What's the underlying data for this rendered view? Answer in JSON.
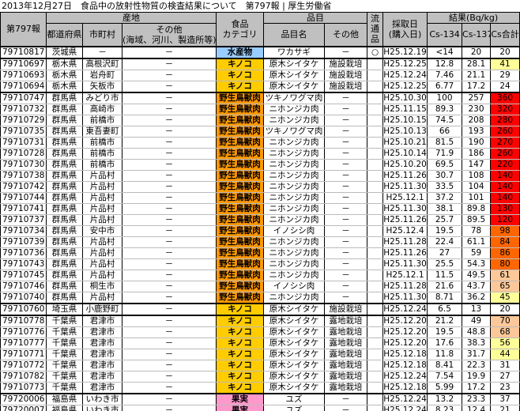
{
  "title": "2013年12月27日　食品中の放射性物質の検査結果について　第797報 | 厚生労働省",
  "header": {
    "report": "第797報",
    "origin": "産地",
    "prefecture": "都道府県",
    "city": "市町村",
    "origin_other": "その他",
    "origin_other_note": "(海域、河川、製造所等)",
    "category": "食品",
    "category2": "カテゴリ",
    "item": "品目",
    "item_name": "品目名",
    "item_other": "その他",
    "distributed": "流",
    "distributed2": "通",
    "distributed3": "品",
    "date": "採取日",
    "date2": "(購入日)",
    "result": "結果(Bq/kg)",
    "cs134": "Cs-134",
    "cs137": "Cs-137",
    "cs_total": "Cs合計"
  },
  "colors": {
    "header": "#c0c0c0",
    "category": {
      "水産物": "#99ccff",
      "キノコ": "#ffcc00",
      "野生鳥獣肉": "#ff9900",
      "果実": "#ff99cc"
    },
    "total_highlight": {
      "over_100": "#ff0000",
      "80_99": "#ff6600",
      "60_79": "#fcc89a",
      "40_59": "#ffff99"
    }
  },
  "rows": [
    {
      "id": "79710817",
      "pref": "茨城県",
      "city": "－",
      "other": "－",
      "cat": "水産物",
      "item": "ワカサギ",
      "item_other": "－",
      "dist": "○",
      "date": "H25.12.19",
      "cs134": "<14",
      "cs137": "20",
      "total": "20",
      "grp": true
    },
    {
      "id": "79710697",
      "pref": "栃木県",
      "city": "高根沢町",
      "other": "－",
      "cat": "キノコ",
      "item": "原木シイタケ",
      "item_other": "施設栽培",
      "dist": "",
      "date": "H25.12.25",
      "cs134": "12.8",
      "cs137": "28.1",
      "total": "41",
      "grp": true
    },
    {
      "id": "79710693",
      "pref": "栃木県",
      "city": "岩舟町",
      "other": "－",
      "cat": "キノコ",
      "item": "原木シイタケ",
      "item_other": "施設栽培",
      "dist": "",
      "date": "H25.12.24",
      "cs134": "7.46",
      "cs137": "21.1",
      "total": "29"
    },
    {
      "id": "79710694",
      "pref": "栃木県",
      "city": "矢板市",
      "other": "－",
      "cat": "キノコ",
      "item": "原木シイタケ",
      "item_other": "施設栽培",
      "dist": "",
      "date": "H25.12.25",
      "cs134": "6.77",
      "cs137": "17.2",
      "total": "24"
    },
    {
      "id": "79710747",
      "pref": "群馬県",
      "city": "みどり市",
      "other": "－",
      "cat": "野生鳥獣肉",
      "item": "ツキノワグマ肉",
      "item_other": "－",
      "dist": "",
      "date": "H25.10.30",
      "cs134": "100",
      "cs137": "257",
      "total": "360",
      "grp": true
    },
    {
      "id": "79710732",
      "pref": "群馬県",
      "city": "高崎市",
      "other": "－",
      "cat": "野生鳥獣肉",
      "item": "ニホンジカ肉",
      "item_other": "－",
      "dist": "",
      "date": "H25.11.15",
      "cs134": "89.3",
      "cs137": "230",
      "total": "320"
    },
    {
      "id": "79710729",
      "pref": "群馬県",
      "city": "前橋市",
      "other": "－",
      "cat": "野生鳥獣肉",
      "item": "ニホンジカ肉",
      "item_other": "－",
      "dist": "",
      "date": "H25.10.15",
      "cs134": "74.5",
      "cs137": "208",
      "total": "280"
    },
    {
      "id": "79710735",
      "pref": "群馬県",
      "city": "東吾妻町",
      "other": "－",
      "cat": "野生鳥獣肉",
      "item": "ツキノワグマ肉",
      "item_other": "－",
      "dist": "",
      "date": "H25.10.13",
      "cs134": "66",
      "cs137": "193",
      "total": "260"
    },
    {
      "id": "79710731",
      "pref": "群馬県",
      "city": "前橋市",
      "other": "－",
      "cat": "野生鳥獣肉",
      "item": "ニホンジカ肉",
      "item_other": "－",
      "dist": "",
      "date": "H25.10.21",
      "cs134": "81.5",
      "cs137": "190",
      "total": "270"
    },
    {
      "id": "79710728",
      "pref": "群馬県",
      "city": "前橋市",
      "other": "－",
      "cat": "野生鳥獣肉",
      "item": "ニホンジカ肉",
      "item_other": "－",
      "dist": "",
      "date": "H25.10.14",
      "cs134": "71.9",
      "cs137": "186",
      "total": "260"
    },
    {
      "id": "79710730",
      "pref": "群馬県",
      "city": "前橋市",
      "other": "－",
      "cat": "野生鳥獣肉",
      "item": "ニホンジカ肉",
      "item_other": "－",
      "dist": "",
      "date": "H25.10.20",
      "cs134": "69.5",
      "cs137": "147",
      "total": "220"
    },
    {
      "id": "79710738",
      "pref": "群馬県",
      "city": "片品村",
      "other": "－",
      "cat": "野生鳥獣肉",
      "item": "ニホンジカ肉",
      "item_other": "－",
      "dist": "",
      "date": "H25.11.26",
      "cs134": "30.7",
      "cs137": "108",
      "total": "140"
    },
    {
      "id": "79710742",
      "pref": "群馬県",
      "city": "片品村",
      "other": "－",
      "cat": "野生鳥獣肉",
      "item": "ニホンジカ肉",
      "item_other": "－",
      "dist": "",
      "date": "H25.11.30",
      "cs134": "33.5",
      "cs137": "104",
      "total": "140"
    },
    {
      "id": "79710744",
      "pref": "群馬県",
      "city": "片品村",
      "other": "－",
      "cat": "野生鳥獣肉",
      "item": "ニホンジカ肉",
      "item_other": "－",
      "dist": "",
      "date": "H25.12.1",
      "cs134": "37.2",
      "cs137": "101",
      "total": "140"
    },
    {
      "id": "79710741",
      "pref": "群馬県",
      "city": "片品村",
      "other": "－",
      "cat": "野生鳥獣肉",
      "item": "ニホンジカ肉",
      "item_other": "－",
      "dist": "",
      "date": "H25.11.30",
      "cs134": "38.1",
      "cs137": "89.8",
      "total": "130"
    },
    {
      "id": "79710737",
      "pref": "群馬県",
      "city": "片品村",
      "other": "－",
      "cat": "野生鳥獣肉",
      "item": "ニホンジカ肉",
      "item_other": "－",
      "dist": "",
      "date": "H25.11.26",
      "cs134": "25.7",
      "cs137": "89.5",
      "total": "120"
    },
    {
      "id": "79710734",
      "pref": "群馬県",
      "city": "安中市",
      "other": "－",
      "cat": "野生鳥獣肉",
      "item": "イノシシ肉",
      "item_other": "－",
      "dist": "",
      "date": "H25.12.4",
      "cs134": "19.5",
      "cs137": "78",
      "total": "98"
    },
    {
      "id": "79710739",
      "pref": "群馬県",
      "city": "片品村",
      "other": "－",
      "cat": "野生鳥獣肉",
      "item": "ニホンジカ肉",
      "item_other": "－",
      "dist": "",
      "date": "H25.11.28",
      "cs134": "22.4",
      "cs137": "61.1",
      "total": "84"
    },
    {
      "id": "79710736",
      "pref": "群馬県",
      "city": "片品村",
      "other": "－",
      "cat": "野生鳥獣肉",
      "item": "ニホンジカ肉",
      "item_other": "－",
      "dist": "",
      "date": "H25.11.26",
      "cs134": "27",
      "cs137": "59",
      "total": "86"
    },
    {
      "id": "79710743",
      "pref": "群馬県",
      "city": "片品村",
      "other": "－",
      "cat": "野生鳥獣肉",
      "item": "ニホンジカ肉",
      "item_other": "－",
      "dist": "",
      "date": "H25.11.30",
      "cs134": "25.5",
      "cs137": "54.3",
      "total": "80"
    },
    {
      "id": "79710745",
      "pref": "群馬県",
      "city": "片品村",
      "other": "－",
      "cat": "野生鳥獣肉",
      "item": "ニホンジカ肉",
      "item_other": "－",
      "dist": "",
      "date": "H25.12.1",
      "cs134": "11.5",
      "cs137": "49.5",
      "total": "61"
    },
    {
      "id": "79710746",
      "pref": "群馬県",
      "city": "桐生市",
      "other": "－",
      "cat": "野生鳥獣肉",
      "item": "イノシシ肉",
      "item_other": "－",
      "dist": "",
      "date": "H25.11.28",
      "cs134": "21.6",
      "cs137": "43.7",
      "total": "65"
    },
    {
      "id": "79710740",
      "pref": "群馬県",
      "city": "片品村",
      "other": "－",
      "cat": "野生鳥獣肉",
      "item": "ニホンジカ肉",
      "item_other": "－",
      "dist": "",
      "date": "H25.11.30",
      "cs134": "8.71",
      "cs137": "36.2",
      "total": "45"
    },
    {
      "id": "79710760",
      "pref": "埼玉県",
      "city": "小鹿野町",
      "other": "－",
      "cat": "キノコ",
      "item": "原木シイタケ",
      "item_other": "施設栽培",
      "dist": "",
      "date": "H25.12.24",
      "cs134": "6.5",
      "cs137": "13",
      "total": "20",
      "grp": true
    },
    {
      "id": "79710778",
      "pref": "千葉県",
      "city": "君津市",
      "other": "－",
      "cat": "キノコ",
      "item": "原木シイタケ",
      "item_other": "露地栽培",
      "dist": "",
      "date": "H25.12.20",
      "cs134": "21.2",
      "cs137": "49",
      "total": "70",
      "grp": true
    },
    {
      "id": "79710776",
      "pref": "千葉県",
      "city": "君津市",
      "other": "－",
      "cat": "キノコ",
      "item": "原木シイタケ",
      "item_other": "露地栽培",
      "dist": "",
      "date": "H25.12.20",
      "cs134": "19.5",
      "cs137": "48.8",
      "total": "68"
    },
    {
      "id": "79710777",
      "pref": "千葉県",
      "city": "君津市",
      "other": "－",
      "cat": "キノコ",
      "item": "原木シイタケ",
      "item_other": "露地栽培",
      "dist": "",
      "date": "H25.12.20",
      "cs134": "17.6",
      "cs137": "38.3",
      "total": "56"
    },
    {
      "id": "79710771",
      "pref": "千葉県",
      "city": "君津市",
      "other": "－",
      "cat": "キノコ",
      "item": "原木シイタケ",
      "item_other": "露地栽培",
      "dist": "",
      "date": "H25.12.18",
      "cs134": "11.8",
      "cs137": "31.7",
      "total": "44"
    },
    {
      "id": "79710772",
      "pref": "千葉県",
      "city": "君津市",
      "other": "－",
      "cat": "キノコ",
      "item": "原木シイタケ",
      "item_other": "露地栽培",
      "dist": "",
      "date": "H25.12.18",
      "cs134": "8.41",
      "cs137": "22.3",
      "total": "31"
    },
    {
      "id": "79710782",
      "pref": "千葉県",
      "city": "君津市",
      "other": "－",
      "cat": "キノコ",
      "item": "原木シイタケ",
      "item_other": "露地栽培",
      "dist": "",
      "date": "H25.12.24",
      "cs134": "7.54",
      "cs137": "19.9",
      "total": "27"
    },
    {
      "id": "79710773",
      "pref": "千葉県",
      "city": "君津市",
      "other": "－",
      "cat": "キノコ",
      "item": "原木シイタケ",
      "item_other": "露地栽培",
      "dist": "",
      "date": "H25.12.18",
      "cs134": "5.99",
      "cs137": "17.2",
      "total": "23"
    },
    {
      "id": "79720006",
      "pref": "福島県",
      "city": "いわき市",
      "other": "－",
      "cat": "果実",
      "item": "ユズ",
      "item_other": "－",
      "dist": "",
      "date": "H25.12.24",
      "cs134": "13.2",
      "cs137": "23.3",
      "total": "37",
      "grp": true
    },
    {
      "id": "79720007",
      "pref": "福島県",
      "city": "いわき市",
      "other": "－",
      "cat": "果実",
      "item": "ユズ",
      "item_other": "－",
      "dist": "",
      "date": "H25.12.24",
      "cs134": "8.23",
      "cs137": "12.4",
      "total": "21"
    }
  ]
}
